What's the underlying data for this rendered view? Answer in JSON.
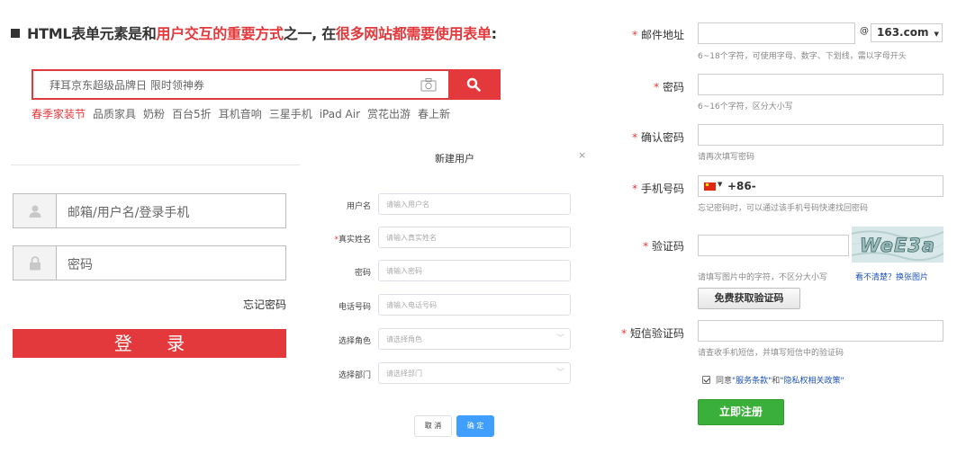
{
  "heading": {
    "part1": "HTML表单元素是和",
    "part2": "用户交互的重要方式",
    "part3": "之一, 在",
    "part4": "很多网站都需要使用表单",
    "part5": ":"
  },
  "search": {
    "placeholder": "拜耳京东超级品牌日 限时领神券",
    "hotwords": [
      "春季家装节",
      "品质家具",
      "奶粉",
      "百台5折",
      "耳机音响",
      "三星手机",
      "iPad Air",
      "赏花出游",
      "春上新"
    ]
  },
  "login": {
    "username_placeholder": "邮箱/用户名/登录手机",
    "password_placeholder": "密码",
    "forgot": "忘记密码",
    "submit": "登 录"
  },
  "dialog": {
    "title": "新建用户",
    "close": "×",
    "fields": [
      {
        "label": "用户名",
        "required": "",
        "placeholder": "请输入用户名",
        "chevron": ""
      },
      {
        "label": "真实姓名",
        "required": "*",
        "placeholder": "请输入真实姓名",
        "chevron": ""
      },
      {
        "label": "密码",
        "required": "",
        "placeholder": "请输入密码",
        "chevron": ""
      },
      {
        "label": "电话号码",
        "required": "",
        "placeholder": "请输入电话号码",
        "chevron": ""
      },
      {
        "label": "选择角色",
        "required": "",
        "placeholder": "请选择角色",
        "chevron": "﹀"
      },
      {
        "label": "选择部门",
        "required": "",
        "placeholder": "请选择部门",
        "chevron": "﹀"
      }
    ],
    "cancel": "取 消",
    "confirm": "确 定"
  },
  "register": {
    "star": "*",
    "email_label": "邮件地址",
    "email_at": "@",
    "email_domain": "163.com",
    "email_domain_arrow": "▼",
    "email_hint": "6~18个字符，可使用字母、数字、下划线，需以字母开头",
    "password_label": "密码",
    "password_hint": "6~16个字符，区分大小写",
    "confirm_label": "确认密码",
    "confirm_hint": "请再次填写密码",
    "phone_label": "手机号码",
    "phone_arrow": "▼",
    "phone_code": "+86-",
    "phone_hint": "忘记密码时，可以通过该手机号码快速找回密码",
    "captcha_label": "验证码",
    "captcha_text": "WeE3a",
    "captcha_hint": "请填写图片中的字符，不区分大小写",
    "captcha_refresh": "看不清楚？换张图片",
    "free_code_button": "免费获取验证码",
    "sms_label": "短信验证码",
    "sms_hint": "请查收手机短信，并填写短信中的验证码",
    "agree_prefix": "同意",
    "agree_terms": "\"服务条款\"",
    "agree_and": "和",
    "agree_privacy": "\"隐私权相关政策\"",
    "submit": "立即注册"
  },
  "colors": {
    "brand_red": "#e4393c",
    "element_blue": "#409eff",
    "register_green": "#3ab03b",
    "link_blue": "#1f54b6"
  },
  "icons": [
    "square-bullet-icon",
    "camera-icon",
    "search-icon",
    "user-icon",
    "lock-icon",
    "close-icon",
    "chevron-down-icon",
    "china-flag-icon",
    "checkbox-icon"
  ]
}
